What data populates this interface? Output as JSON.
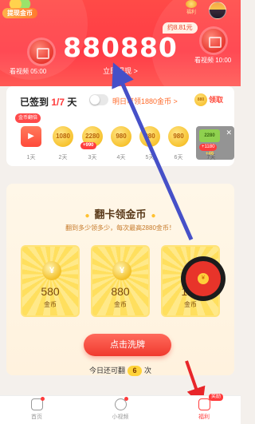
{
  "header": {
    "badge_label": "提现金币",
    "big_amount": "880880",
    "approx_label": "约8.81元",
    "withdraw_link": "立即提现 >",
    "left_bubble_label": "看视频 05:00",
    "right_bubble_label": "看视频 10:00",
    "right_badge_label": "福利"
  },
  "checkin": {
    "title_prefix": "已签到",
    "title_count": "1/7",
    "title_suffix": "天",
    "tomorrow_text": "明日可领1880金币 >",
    "claim_coin": "880",
    "claim_label": "领取",
    "flip_tag": "金币翻倍",
    "days": [
      {
        "coin": "▶",
        "plus": "",
        "label": "1天"
      },
      {
        "coin": "1080",
        "plus": "",
        "label": "2天"
      },
      {
        "coin": "2280",
        "plus": "+990",
        "label": "3天"
      },
      {
        "coin": "980",
        "plus": "",
        "label": "4天"
      },
      {
        "coin": "980",
        "plus": "",
        "label": "5天"
      },
      {
        "coin": "980",
        "plus": "",
        "label": "6天"
      },
      {
        "coin": "",
        "plus": "",
        "label": "7天"
      }
    ]
  },
  "popup": {
    "box_value": "2280",
    "plus_value": "+1180",
    "bonus_value": "+46"
  },
  "flip_game": {
    "title": "翻卡领金币",
    "subtitle": "翻到多少领多少，每次最高2880金币！",
    "cards": [
      {
        "amount": "580",
        "unit": "金币"
      },
      {
        "amount": "880",
        "unit": "金币"
      },
      {
        "amount": "12..",
        "unit": "金币"
      }
    ],
    "shuffle_button": "点击洗牌",
    "remain_prefix": "今日还可翻",
    "remain_count": "6",
    "remain_suffix": "次"
  },
  "tabbar": {
    "tabs": [
      {
        "label": "首页"
      },
      {
        "label": "小视频"
      },
      {
        "label": "福利",
        "flag": "奖励"
      }
    ]
  },
  "colors": {
    "header_red": "#ff4a47",
    "accent_red": "#ff3b3b",
    "gold": "#f7c330",
    "arrow_blue": "#4650c8",
    "arrow_red": "#e8262a"
  }
}
